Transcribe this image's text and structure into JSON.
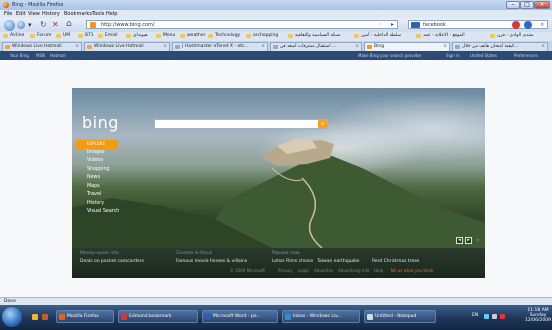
{
  "window": {
    "title": "Bing - Mozilla Firefox"
  },
  "menu": [
    "File",
    "Edit",
    "View",
    "History",
    "Bookmarks",
    "Tools",
    "Help"
  ],
  "nav": {
    "url": "http://www.bing.com/",
    "search_value": "facebook"
  },
  "bookmarks": [
    "Airline",
    "Forum",
    "UM",
    "871",
    "Email",
    "هيونداي",
    "Menu",
    "weather",
    "Technology",
    "archopping",
    "شبكة السياسية والثقافية",
    "سلطة الداخلية - أمين",
    "الموقع - الاعلانة - عمد",
    "منتدى الوادي - فرن"
  ],
  "tabs": [
    {
      "label": "Windows Live Hotmail",
      "active": false
    },
    {
      "label": "Windows Live Hotmail",
      "active": false
    },
    {
      "label": "| Hashmaster eTenet X - etc...",
      "active": false
    },
    {
      "label": "استقبال ممثرفات اسعد فن ...",
      "active": false
    },
    {
      "label": "Bing",
      "active": true
    },
    {
      "label": "كيفية امتحان هاتف من خلال...",
      "active": false
    }
  ],
  "bing_topbar": {
    "left_links": [
      "Your Bing",
      "MSN",
      "Hotmail"
    ],
    "right_links": [
      "Make Bing your search provider",
      "Sign in",
      "United States",
      "Preferences"
    ]
  },
  "bing": {
    "logo": "bing",
    "search_placeholder": "",
    "left_nav": [
      {
        "label": "EXPLORE",
        "selected": true
      },
      {
        "label": "Images",
        "selected": false
      },
      {
        "label": "Videos",
        "selected": false
      },
      {
        "label": "Shopping",
        "selected": false
      },
      {
        "label": "News",
        "selected": false
      },
      {
        "label": "Maps",
        "selected": false
      },
      {
        "label": "Travel",
        "selected": false
      },
      {
        "label": "History",
        "selected": false
      },
      {
        "label": "Visual Search",
        "selected": false
      }
    ],
    "bottom": {
      "col1": {
        "heading": "Money-saver info",
        "text": "Deals on pocket camcorders"
      },
      "col2": {
        "heading": "Cinema in focus",
        "text": "Famous movie heroes & villains"
      },
      "col3": {
        "heading": "Popular now",
        "items": [
          "Lehar Rims choice",
          "Taiwan earthquake",
          "Rent Christmas trees"
        ]
      }
    },
    "footer": {
      "links": [
        "© 2009 Microsoft",
        "Privacy",
        "Legal",
        "Advertise",
        "Advertising Info",
        "Help"
      ],
      "feedback": "Tell us what you think"
    }
  },
  "status": {
    "text": "Done"
  },
  "taskbar": {
    "tasks": [
      "Mozilla Firefox",
      "Edmond.bookmark",
      "Microsoft Word - pe...",
      "Inbox - Windows Liv...",
      "Untitled - Notepad"
    ],
    "tray_lang": "EN",
    "clock": {
      "time": "11:18 AM",
      "day": "Sunday",
      "date": "12/06/2009"
    }
  },
  "colors": {
    "bing_orange": "#f39c12",
    "taskbar": "#1d3558",
    "link_blue": "#7f95ad"
  }
}
